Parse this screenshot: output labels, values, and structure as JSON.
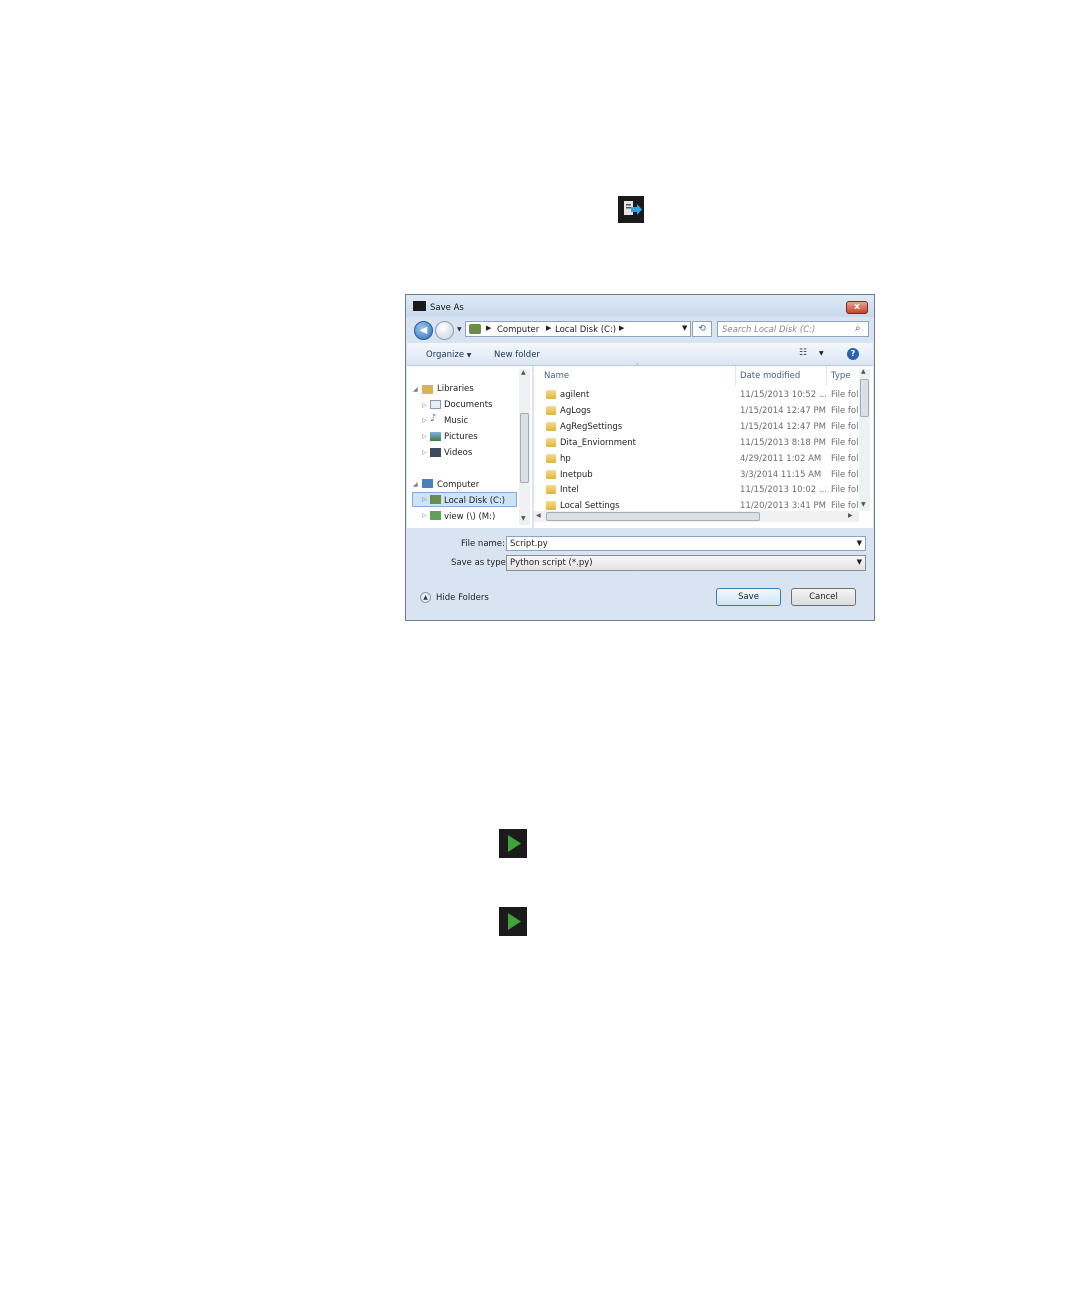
{
  "dialog": {
    "title": "Save As",
    "close_glyph": "x",
    "address": {
      "crumbs": [
        "Computer",
        "Local Disk (C:)"
      ]
    },
    "search_placeholder": "Search Local Disk (C:)",
    "toolbar": {
      "organize": "Organize",
      "new_folder": "New folder"
    },
    "nav": {
      "libraries": "Libraries",
      "documents": "Documents",
      "music": "Music",
      "pictures": "Pictures",
      "videos": "Videos",
      "computer": "Computer",
      "local_disk": "Local Disk (C:)",
      "view_drive": "view (\\) (M:)"
    },
    "columns": {
      "name": "Name",
      "date": "Date modified",
      "type": "Type"
    },
    "files": [
      {
        "name": "agilent",
        "date": "11/15/2013 10:52 ...",
        "type": "File folder"
      },
      {
        "name": "AgLogs",
        "date": "1/15/2014 12:47 PM",
        "type": "File folder"
      },
      {
        "name": "AgRegSettings",
        "date": "1/15/2014 12:47 PM",
        "type": "File folder"
      },
      {
        "name": "Dita_Enviornment",
        "date": "11/15/2013 8:18 PM",
        "type": "File folder"
      },
      {
        "name": "hp",
        "date": "4/29/2011 1:02 AM",
        "type": "File folder"
      },
      {
        "name": "Inetpub",
        "date": "3/3/2014 11:15 AM",
        "type": "File folder"
      },
      {
        "name": "Intel",
        "date": "11/15/2013 10:02 ...",
        "type": "File folder"
      },
      {
        "name": "Local Settings",
        "date": "11/20/2013 3:41 PM",
        "type": "File folder"
      }
    ],
    "filename_label": "File name:",
    "filename_value": "Script.py",
    "savetype_label": "Save as type:",
    "savetype_value": "Python script (*.py)",
    "hide_folders": "Hide Folders",
    "save_button": "Save",
    "cancel_button": "Cancel"
  },
  "icons": {
    "export": "export-script-icon",
    "play": "play-icon"
  },
  "colors": {
    "play_green": "#3fa33a",
    "icon_bg": "#1b1b1b",
    "export_blue": "#2aa8e0"
  }
}
